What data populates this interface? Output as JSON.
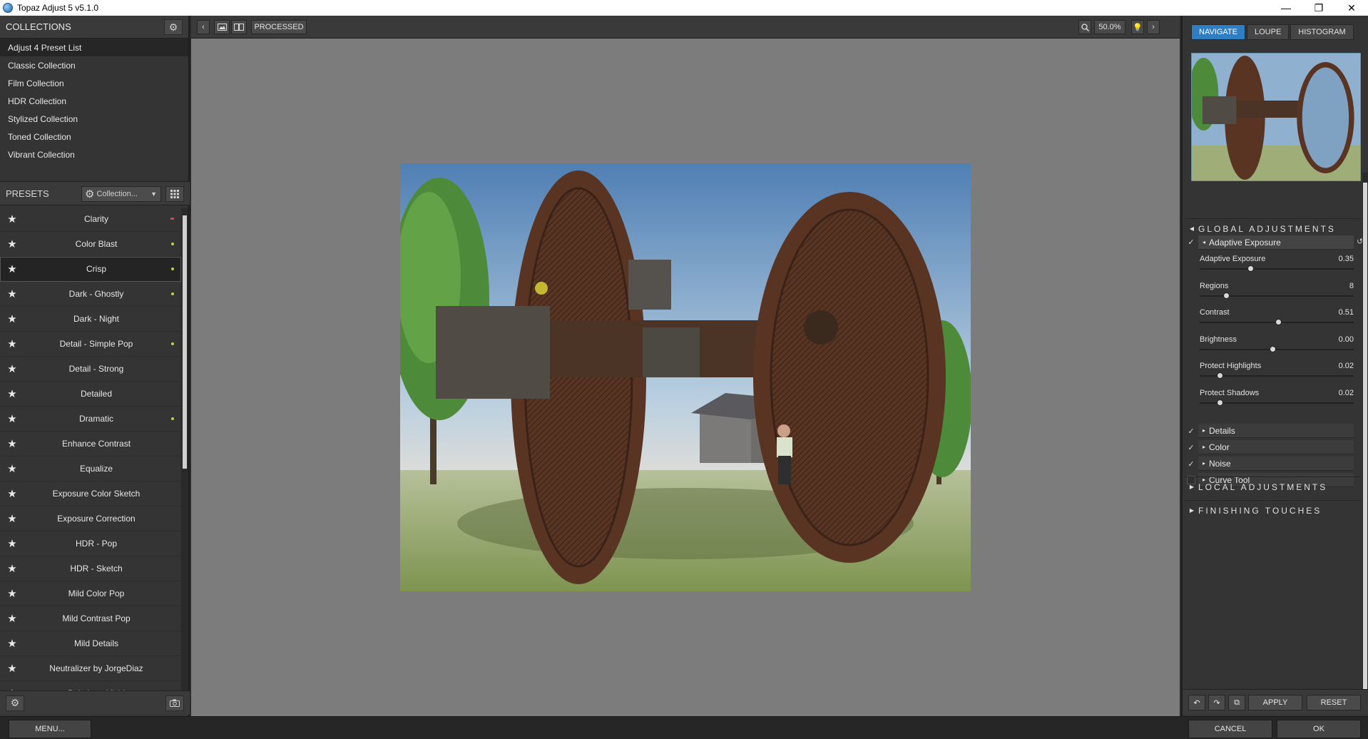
{
  "window": {
    "title": "Topaz Adjust 5 v5.1.0",
    "minimize": "—",
    "maximize": "❐",
    "close": "✕"
  },
  "collections": {
    "header": "COLLECTIONS",
    "items": [
      {
        "label": "Adjust 4 Preset List",
        "selected": true
      },
      {
        "label": "Classic Collection"
      },
      {
        "label": "Film Collection"
      },
      {
        "label": "HDR Collection"
      },
      {
        "label": "Stylized Collection"
      },
      {
        "label": "Toned Collection"
      },
      {
        "label": "Vibrant Collection"
      }
    ]
  },
  "presets": {
    "header": "PRESETS",
    "dropdown_value": "Collection...",
    "items": [
      {
        "label": "Clarity",
        "dot": "red"
      },
      {
        "label": "Color Blast",
        "dot": "green"
      },
      {
        "label": "Crisp",
        "dot": "green",
        "selected": true
      },
      {
        "label": "Dark - Ghostly",
        "dot": "green"
      },
      {
        "label": "Dark - Night"
      },
      {
        "label": "Detail - Simple Pop",
        "dot": "green"
      },
      {
        "label": "Detail - Strong"
      },
      {
        "label": "Detailed"
      },
      {
        "label": "Dramatic",
        "dot": "green"
      },
      {
        "label": "Enhance Contrast"
      },
      {
        "label": "Equalize"
      },
      {
        "label": "Exposure Color Sketch"
      },
      {
        "label": "Exposure Correction"
      },
      {
        "label": "HDR - Pop"
      },
      {
        "label": "HDR - Sketch"
      },
      {
        "label": "Mild Color Pop"
      },
      {
        "label": "Mild Contrast Pop"
      },
      {
        "label": "Mild Details"
      },
      {
        "label": "Neutralizer by JorgeDiaz"
      },
      {
        "label": "Painting - Vivid"
      }
    ]
  },
  "toolbar": {
    "view_mode": "PROCESSED",
    "zoom": "50.0%"
  },
  "nav_tabs": [
    "NAVIGATE",
    "LOUPE",
    "HISTOGRAM"
  ],
  "global": {
    "header": "GLOBAL ADJUSTMENTS",
    "adaptive_header": "Adaptive Exposure",
    "sliders": [
      {
        "label": "Adaptive Exposure",
        "value": "0.35",
        "pos": 0.33
      },
      {
        "label": "Regions",
        "value": "8",
        "pos": 0.17
      },
      {
        "label": "Contrast",
        "value": "0.51",
        "pos": 0.51
      },
      {
        "label": "Brightness",
        "value": "0.00",
        "pos": 0.47
      },
      {
        "label": "Protect Highlights",
        "value": "0.02",
        "pos": 0.13
      },
      {
        "label": "Protect Shadows",
        "value": "0.02",
        "pos": 0.13
      }
    ],
    "subsections": [
      {
        "label": "Details",
        "checked": true
      },
      {
        "label": "Color",
        "checked": true
      },
      {
        "label": "Noise",
        "checked": true
      },
      {
        "label": "Curve Tool",
        "checked": false
      }
    ]
  },
  "local": {
    "header": "LOCAL ADJUSTMENTS"
  },
  "finishing": {
    "header": "FINISHING TOUCHES"
  },
  "right_footer": {
    "apply": "APPLY",
    "reset": "RESET"
  },
  "bottom": {
    "menu": "MENU...",
    "cancel": "CANCEL",
    "ok": "OK"
  }
}
